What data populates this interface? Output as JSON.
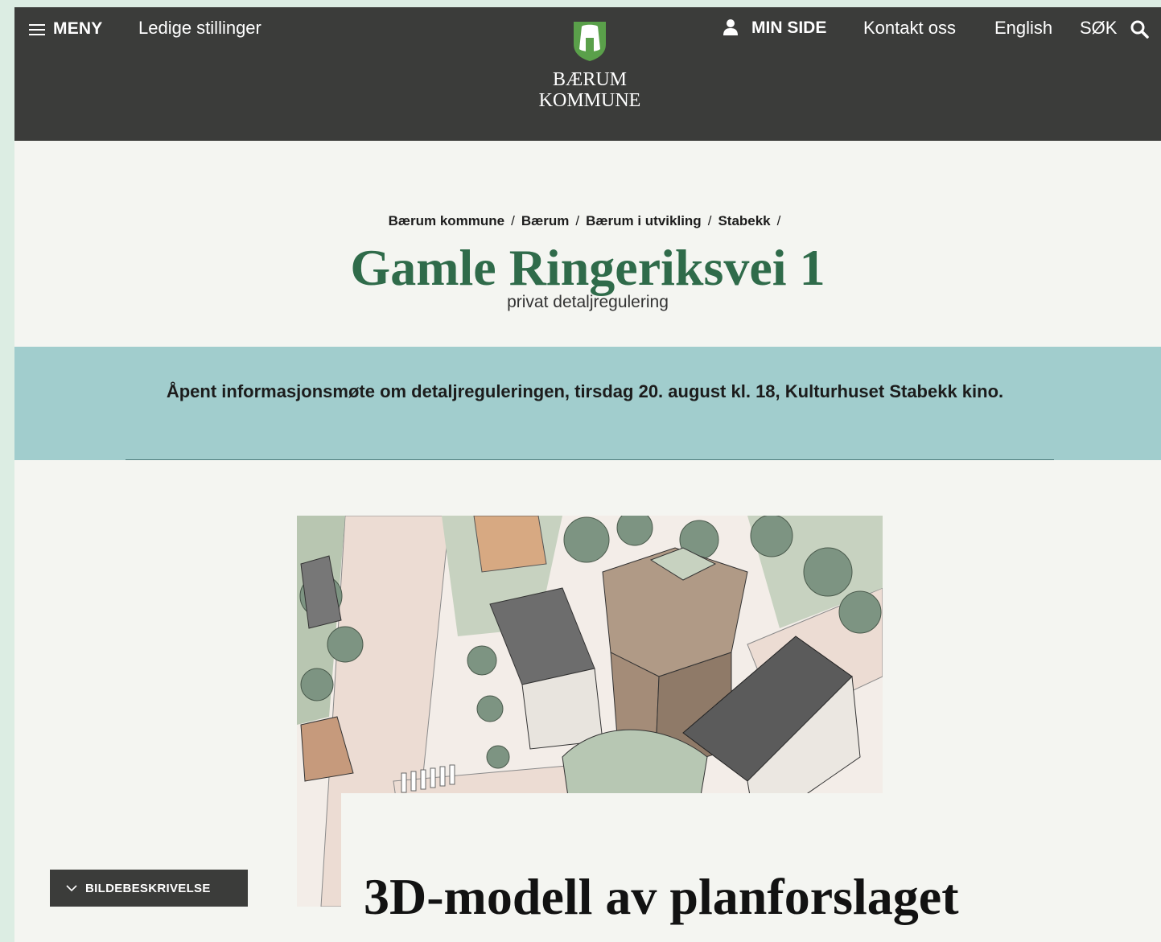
{
  "header": {
    "menu_label": "MENY",
    "jobs_link": "Ledige stillinger",
    "logo_line1": "BÆRUM",
    "logo_line2": "KOMMUNE",
    "my_page": "MIN SIDE",
    "contact": "Kontakt oss",
    "english": "English",
    "search": "SØK"
  },
  "breadcrumb": [
    "Bærum kommune",
    "Bærum",
    "Bærum i utvikling",
    "Stabekk"
  ],
  "page": {
    "title": "Gamle Ringeriksvei 1",
    "subtitle": "privat detaljregulering"
  },
  "banner": {
    "text": "Åpent informasjonsmøte om detaljreguleringen, tirsdag 20. august kl. 18, Kulturhuset Stabekk kino."
  },
  "image": {
    "description_button": "BILDEBESKRIVELSE",
    "caption_title": "3D-modell av planforslaget"
  },
  "colors": {
    "header_bg": "#3b3c3a",
    "title_green": "#2f6b4a",
    "banner_bg": "#a1cdcd",
    "page_bg": "#f4f5f1",
    "outer_bg": "#dcede3"
  }
}
